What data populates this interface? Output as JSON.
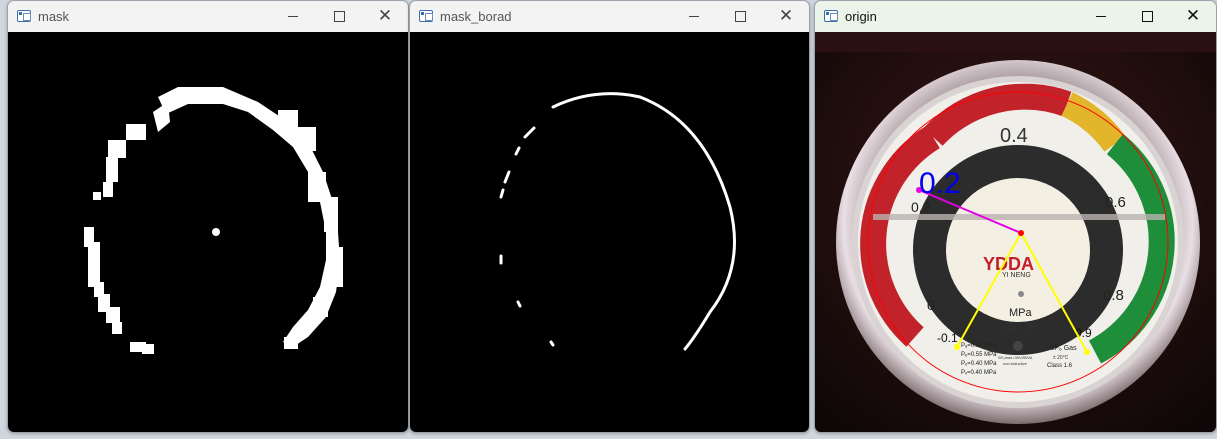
{
  "windows": [
    {
      "id": "mask",
      "title": "mask"
    },
    {
      "id": "mask_borad",
      "title": "mask_borad"
    },
    {
      "id": "origin",
      "title": "origin"
    }
  ],
  "controls": {
    "minimize": "minimize",
    "maximize": "maximize",
    "close": "close"
  },
  "gauge": {
    "scale_labels": [
      "0.4",
      "0.6",
      "0.8",
      "0.9",
      "0.2",
      "0",
      "-0.1"
    ],
    "brand": "YDDA",
    "brand_sub": "YI NENG",
    "unit": "MPa",
    "umax": "Umax = 250V",
    "gas": "SF₆ Gas",
    "temp": "± 20°C",
    "class": "Class 1.6",
    "specs": [
      "Pₐ=0.50 MPa",
      "Pₑ=0.55 MPa",
      "Pₒ=0.40 MPa",
      "Pₓ=0.40 MPa"
    ],
    "spec_mid": "SF₆max=30V/50VA",
    "spec_mid2": "non-inductive"
  },
  "detection": {
    "reading": "0.2"
  },
  "colors": {
    "reading_text": "#0000ee",
    "pointer_line": "#e600e6",
    "range_lines": "#ffff00",
    "fit_circle": "#ff0000"
  }
}
